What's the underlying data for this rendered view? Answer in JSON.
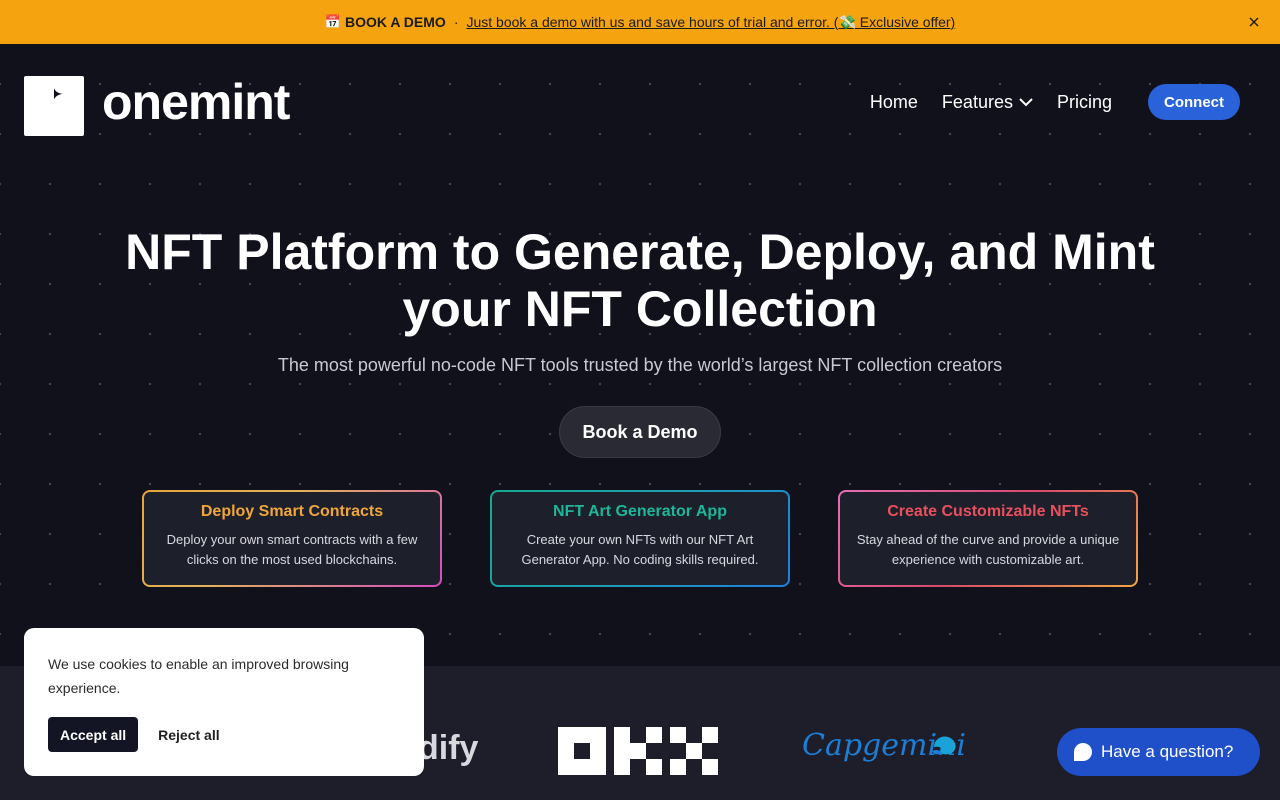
{
  "announcement": {
    "icon": "calendar-icon",
    "label": "BOOK A DEMO",
    "separator": "·",
    "link_text": "Just book a demo with us and save hours of trial and error. (💸 Exclusive offer)",
    "close_icon": "close-icon"
  },
  "header": {
    "brand": "onemint",
    "nav": [
      {
        "label": "Home"
      },
      {
        "label": "Features"
      },
      {
        "label": "Pricing"
      }
    ],
    "connect_label": "Connect"
  },
  "hero": {
    "title_line1": "NFT Platform to Generate, Deploy, and Mint",
    "title_line2": "your NFT Collection",
    "subtitle": "The most powerful no-code NFT tools trusted by the world’s largest NFT collection creators",
    "cta": "Book a Demo"
  },
  "cards": [
    {
      "title": "Deploy Smart Contracts",
      "desc": "Deploy your own smart contracts with a few clicks on the most used blockchains."
    },
    {
      "title": "NFT Art Generator App",
      "desc": "Create your own NFTs with our NFT Art Generator App. No coding skills required."
    },
    {
      "title": "Create Customizable NFTs",
      "desc": "Stay ahead of the curve and provide a unique experience with customizable art."
    }
  ],
  "partner_logos": {
    "dify": "dify",
    "capgemini": "Capgemini"
  },
  "cookie": {
    "text": "We use cookies to enable an improved browsing experience.",
    "accept": "Accept all",
    "reject": "Reject all"
  },
  "chat": {
    "label": "Have a question?"
  },
  "colors": {
    "announcement_bg": "#f5a30f",
    "page_bg": "#11111c",
    "connect_bg": "#2a62d9",
    "chat_bg": "#1f4fc9"
  }
}
